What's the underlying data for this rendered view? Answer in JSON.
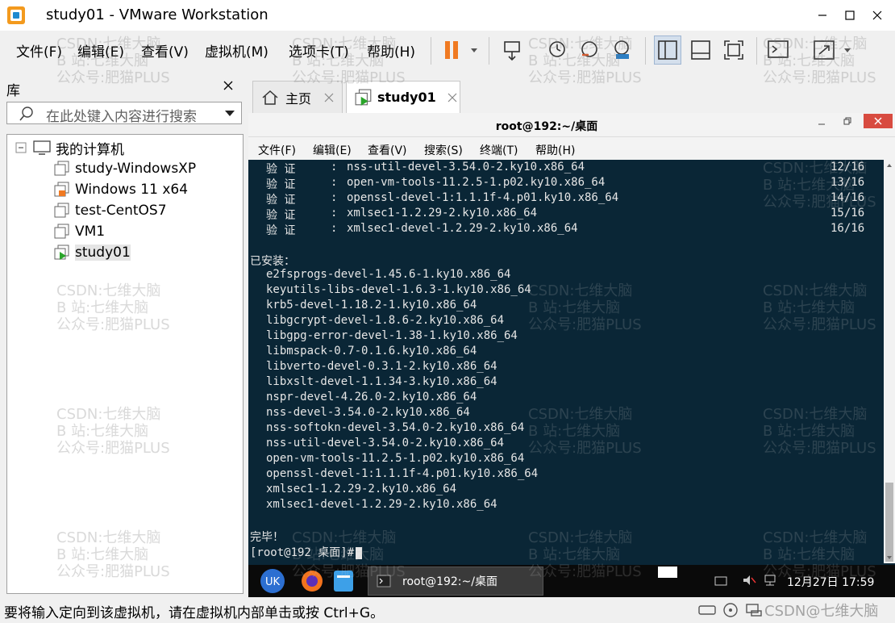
{
  "window": {
    "title": "study01 - VMware Workstation"
  },
  "menu": [
    "文件(F)",
    "编辑(E)",
    "查看(V)",
    "虚拟机(M)",
    "选项卡(T)",
    "帮助(H)"
  ],
  "library": {
    "title": "库",
    "search_placeholder": "在此处键入内容进行搜索",
    "root": "我的计算机",
    "vms": [
      "study-WindowsXP",
      "Windows 11 x64",
      "test-CentOS7",
      "VM1",
      "study01"
    ]
  },
  "tabs": {
    "home": "主页",
    "active": "study01"
  },
  "guest": {
    "title": "root@192:~/桌面",
    "menu": [
      "文件(F)",
      "编辑(E)",
      "查看(V)",
      "搜索(S)",
      "终端(T)",
      "帮助(H)"
    ],
    "terminal": {
      "verify": [
        {
          "label": "验 证",
          "pkg": "nss-util-devel-3.54.0-2.ky10.x86_64",
          "count": "12/16"
        },
        {
          "label": "验 证",
          "pkg": "open-vm-tools-11.2.5-1.p02.ky10.x86_64",
          "count": "13/16"
        },
        {
          "label": "验 证",
          "pkg": "openssl-devel-1:1.1.1f-4.p01.ky10.x86_64",
          "count": "14/16"
        },
        {
          "label": "验 证",
          "pkg": "xmlsec1-1.2.29-2.ky10.x86_64",
          "count": "15/16"
        },
        {
          "label": "验 证",
          "pkg": "xmlsec1-devel-1.2.29-2.ky10.x86_64",
          "count": "16/16"
        }
      ],
      "installed_header": "已安装：",
      "installed": [
        "e2fsprogs-devel-1.45.6-1.ky10.x86_64",
        "keyutils-libs-devel-1.6.3-1.ky10.x86_64",
        "krb5-devel-1.18.2-1.ky10.x86_64",
        "libgcrypt-devel-1.8.6-2.ky10.x86_64",
        "libgpg-error-devel-1.38-1.ky10.x86_64",
        "libmspack-0.7-0.1.6.ky10.x86_64",
        "libverto-devel-0.3.1-2.ky10.x86_64",
        "libxslt-devel-1.1.34-3.ky10.x86_64",
        "nspr-devel-4.26.0-2.ky10.x86_64",
        "nss-devel-3.54.0-2.ky10.x86_64",
        "nss-softokn-devel-3.54.0-2.ky10.x86_64",
        "nss-util-devel-3.54.0-2.ky10.x86_64",
        "open-vm-tools-11.2.5-1.p02.ky10.x86_64",
        "openssl-devel-1:1.1.1f-4.p01.ky10.x86_64",
        "xmlsec1-1.2.29-2.ky10.x86_64",
        "xmlsec1-devel-1.2.29-2.ky10.x86_64"
      ],
      "done": "完毕！",
      "prompt": "[root@192 桌面]#"
    },
    "taskbar": {
      "app": "root@192:~/桌面",
      "clock": "12月27日 17:59"
    }
  },
  "status": "要将输入定向到该虚拟机，请在虚拟机内部单击或按 Ctrl+G。",
  "watermark": {
    "l1": "CSDN:七维大脑",
    "l2": "B 站:七维大脑",
    "l3": "公众号:肥猫PLUS",
    "corner": "CSDN@七维大脑"
  }
}
